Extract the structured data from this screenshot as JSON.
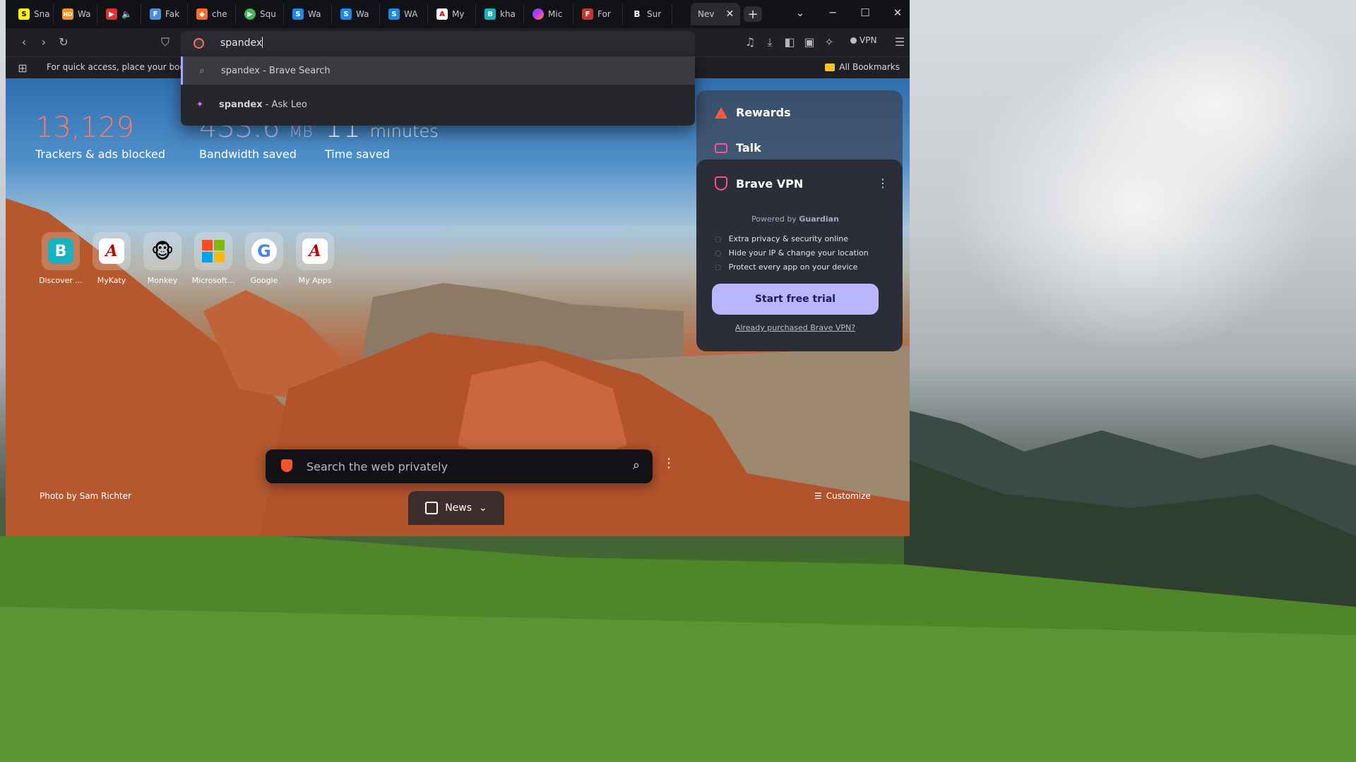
{
  "tabs": [
    {
      "label": "Sna",
      "icon": "snapchat-icon",
      "color": "#fffc00",
      "glyph": "S"
    },
    {
      "label": "Wa",
      "icon": "hd-icon",
      "color": "#f7931e",
      "glyph": "HD"
    },
    {
      "label": "",
      "icon": "video-icon",
      "color": "#e03131",
      "glyph": "▶"
    },
    {
      "label": "Fak",
      "icon": "doc-icon",
      "color": "#4a90d9",
      "glyph": "F"
    },
    {
      "label": "che",
      "icon": "gitlab-icon",
      "color": "#fc6d26",
      "glyph": "◆"
    },
    {
      "label": "Squ",
      "icon": "play-icon",
      "color": "#3fb950",
      "glyph": "▶"
    },
    {
      "label": "Wa",
      "icon": "s-icon",
      "color": "#1e88e5",
      "glyph": "S"
    },
    {
      "label": "Wa",
      "icon": "s-icon",
      "color": "#1e88e5",
      "glyph": "S"
    },
    {
      "label": "WA",
      "icon": "s-icon",
      "color": "#1e88e5",
      "glyph": "S"
    },
    {
      "label": "My",
      "icon": "myapps-icon",
      "color": "#ffffff",
      "glyph": "A"
    },
    {
      "label": "kha",
      "icon": "b-teal-icon",
      "color": "#17b3c2",
      "glyph": "B"
    },
    {
      "label": "Mic",
      "icon": "copilot-icon",
      "color": "#7b61ff",
      "glyph": "◕"
    },
    {
      "label": "For",
      "icon": "forum-icon",
      "color": "#c0392b",
      "glyph": "F"
    },
    {
      "label": "Sur",
      "icon": "b-bold-icon",
      "color": "#121317",
      "glyph": "B"
    },
    {
      "label": "Nev",
      "icon": "",
      "color": "",
      "glyph": ""
    }
  ],
  "omnibox": {
    "value": "spandex"
  },
  "vpn_chip": "VPN",
  "bookmarks": {
    "hint": "For quick access, place your bookm",
    "all": "All Bookmarks"
  },
  "suggestions": [
    {
      "bold": "spandex",
      "rest": " - Brave Search",
      "icon": "search-icon"
    },
    {
      "bold": "spandex",
      "rest": " - Ask Leo",
      "icon": "leo-icon"
    }
  ],
  "stats": [
    {
      "num": "13,129",
      "unit": "",
      "label": "Trackers & ads blocked",
      "color": "#ff7b5c"
    },
    {
      "num": "433.6",
      "unit": "MB",
      "label": "Bandwidth saved",
      "color": "#c9c7ff"
    },
    {
      "num": "11",
      "unit": "minutes",
      "label": "Time saved",
      "color": "#ffffff"
    }
  ],
  "tiles": [
    {
      "label": "Discover ...",
      "icon": "b-icon",
      "glyph": "B"
    },
    {
      "label": "MyKaty",
      "icon": "myapps-icon",
      "glyph": "A"
    },
    {
      "label": "Monkey",
      "icon": "monkey-icon",
      "glyph": "🐵"
    },
    {
      "label": "Microsoft...",
      "icon": "microsoft-icon",
      "glyph": ""
    },
    {
      "label": "Google",
      "icon": "google-icon",
      "glyph": "G"
    },
    {
      "label": "My Apps",
      "icon": "myapps-icon",
      "glyph": "A"
    }
  ],
  "side": {
    "rewards": "Rewards",
    "talk": "Talk",
    "vpn_title": "Brave VPN",
    "powered": "Powered by",
    "guardian": "Guardian",
    "features": [
      "Extra privacy & security online",
      "Hide your IP & change your location",
      "Protect every app on your device"
    ],
    "trial": "Start free trial",
    "purchased": "Already purchased Brave VPN?"
  },
  "search": {
    "placeholder": "Search the web privately"
  },
  "news": "News",
  "photo_credit": "Photo by Sam Richter",
  "customize": "Customize"
}
